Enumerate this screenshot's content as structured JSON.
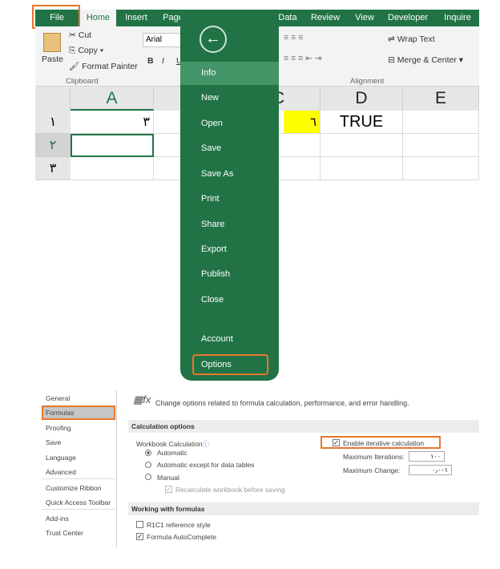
{
  "ribbon": {
    "tabs": [
      "File",
      "Home",
      "Insert",
      "Page",
      "Data",
      "Review",
      "View",
      "Developer",
      "Inquire"
    ],
    "clipboard": {
      "paste": "Paste",
      "cut": "Cut",
      "copy": "Copy",
      "format_painter": "Format Painter",
      "group": "Clipboard"
    },
    "font": {
      "name": "Arial",
      "bold": "B",
      "italic": "I",
      "underline": "U"
    },
    "alignment": {
      "wrap_text": "Wrap Text",
      "merge_center": "Merge & Center",
      "group": "Alignment"
    }
  },
  "sheet": {
    "columns": [
      "A",
      "C",
      "D",
      "E"
    ],
    "rows": [
      "١",
      "٢",
      "٣"
    ],
    "cells": {
      "A1": "٣",
      "C1": "٦",
      "D1": "TRUE"
    },
    "highlight_color": "#ffff00"
  },
  "backstage": {
    "items": [
      "Info",
      "New",
      "Open",
      "Save",
      "Save As",
      "Print",
      "Share",
      "Export",
      "Publish",
      "Close",
      "Account",
      "Options"
    ],
    "selected": "Info",
    "accent": "#217346"
  },
  "options": {
    "nav": [
      "General",
      "Formulas",
      "Proofing",
      "Save",
      "Language",
      "Advanced",
      "Customize Ribbon",
      "Quick Access Toolbar",
      "Add-ins",
      "Trust Center"
    ],
    "selected": "Formulas",
    "header": "Change options related to formula calculation, performance, and error handling.",
    "calc_section": "Calculation options",
    "workbook_calc": "Workbook Calculation",
    "automatic": "Automatic",
    "auto_except": "Automatic except for data tables",
    "manual": "Manual",
    "recalc": "Recalculate workbook before saving",
    "iterative": "Enable iterative calculation",
    "max_iter_label": "Maximum Iterations:",
    "max_iter": "١٠٠",
    "max_change_label": "Maximum Change:",
    "max_change": "٠٫٠٠١",
    "formulas_section": "Working with formulas",
    "r1c1": "R1C1 reference style",
    "autocomplete": "Formula AutoComplete",
    "highlight_color": "#e8762c"
  }
}
